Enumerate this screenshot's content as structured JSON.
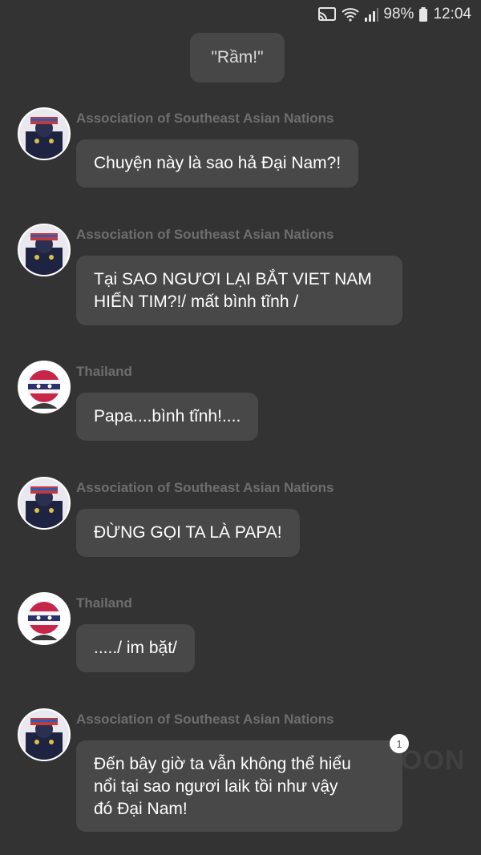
{
  "status_bar": {
    "battery": "98%",
    "time": "12:04"
  },
  "narration": "\"Rầm!\"",
  "messages": [
    {
      "sender": "Association of Southeast Asian Nations",
      "avatar": "asean-avatar",
      "text": "Chuyện này là sao hả Đại Nam?!"
    },
    {
      "sender": "Association of Southeast Asian Nations",
      "avatar": "asean-avatar",
      "line1": "Tại SAO NGƯƠI LẠI BẮT VIET NAM",
      "line2": "HIẾN TIM?!/ mất bình tĩnh /"
    },
    {
      "sender": "Thailand",
      "avatar": "thailand-avatar",
      "text": "Papa....bình tĩnh!...."
    },
    {
      "sender": "Association of Southeast Asian Nations",
      "avatar": "asean-avatar",
      "text": "ĐỪNG GỌI TA LÀ PAPA!"
    },
    {
      "sender": "Thailand",
      "avatar": "thailand-avatar",
      "text": "...../ im bặt/"
    },
    {
      "sender": "Association of Southeast Asian Nations",
      "avatar": "asean-avatar",
      "line1": "Đến bây giờ ta vẫn không thể hiểu",
      "line2": "nổi tại sao ngươi laik tồi như vậy",
      "line3": "đó Đại Nam!",
      "badge": "1"
    }
  ],
  "watermark": "OON"
}
